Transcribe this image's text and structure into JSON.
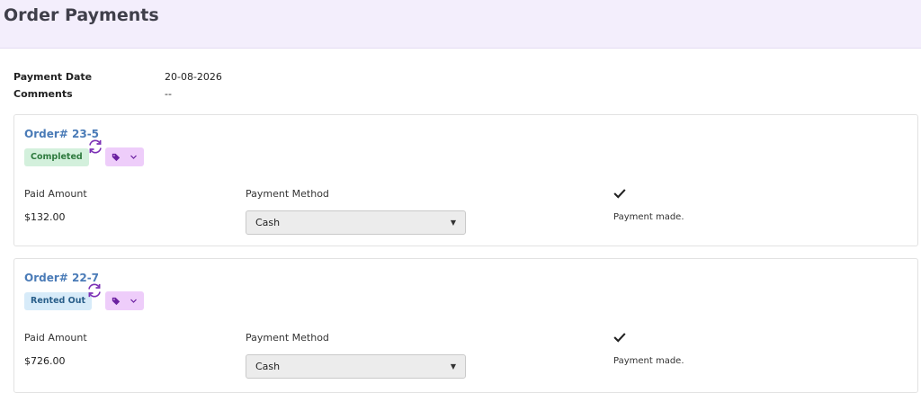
{
  "page": {
    "title": "Order Payments"
  },
  "summary": {
    "payment_date_label": "Payment Date",
    "payment_date": "20-08-2026",
    "comments_label": "Comments",
    "comments": "--"
  },
  "orders": [
    {
      "order_number": "Order# 23-5",
      "status": "Completed",
      "paid_amount_label": "Paid Amount",
      "paid_amount": "$132.00",
      "payment_method_label": "Payment Method",
      "payment_method": "Cash",
      "payment_status": "Payment made."
    },
    {
      "order_number": "Order# 22-7",
      "status": "Rented Out",
      "paid_amount_label": "Paid Amount",
      "paid_amount": "$726.00",
      "payment_method_label": "Payment Method",
      "payment_method": "Cash",
      "payment_status": "Payment made."
    }
  ],
  "icons": {
    "sync": "sync-icon",
    "tag": "tag-icon",
    "chevron": "chevron-down-icon",
    "check": "check-icon",
    "caret": "caret-down-icon"
  },
  "colors": {
    "header_bg": "#f3eefc",
    "accent_purple": "#7b2fb5",
    "link_blue": "#4a7bb7",
    "completed_bg": "#d3f0dc",
    "rented_bg": "#d7ebf9"
  }
}
